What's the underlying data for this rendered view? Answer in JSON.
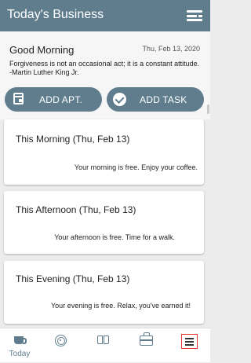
{
  "appbar": {
    "title": "Today's Business",
    "menu_icon": "menu-toggle-icon"
  },
  "greeting_card": {
    "greeting": "Good Morning",
    "date": "Thu, Feb 13, 2020",
    "quote": "Forgiveness is not an occasional act; it is a constant attitude. -Martin Luther King Jr."
  },
  "actions": {
    "add_apt_label": "ADD APT.",
    "add_task_label": "ADD TASK"
  },
  "sections": [
    {
      "title": "This Morning (Thu, Feb 13)",
      "message": "Your morning is free. Enjoy your coffee."
    },
    {
      "title": "This Afternoon (Thu, Feb 13)",
      "message": "Your afternoon is free. Time for a walk."
    },
    {
      "title": "This Evening (Thu, Feb 13)",
      "message": "Your evening is free. Relax, you've earned it!"
    }
  ],
  "bottom_nav": {
    "items": [
      {
        "label": "Today",
        "icon": "coffee-cup-icon"
      },
      {
        "label": "",
        "icon": "target-icon"
      },
      {
        "label": "",
        "icon": "book-icon"
      },
      {
        "label": "",
        "icon": "briefcase-icon"
      },
      {
        "label": "",
        "icon": "menu-icon"
      }
    ]
  },
  "colors": {
    "accent": "#5f7d8d",
    "highlight": "#e53935",
    "background": "#ececec"
  }
}
